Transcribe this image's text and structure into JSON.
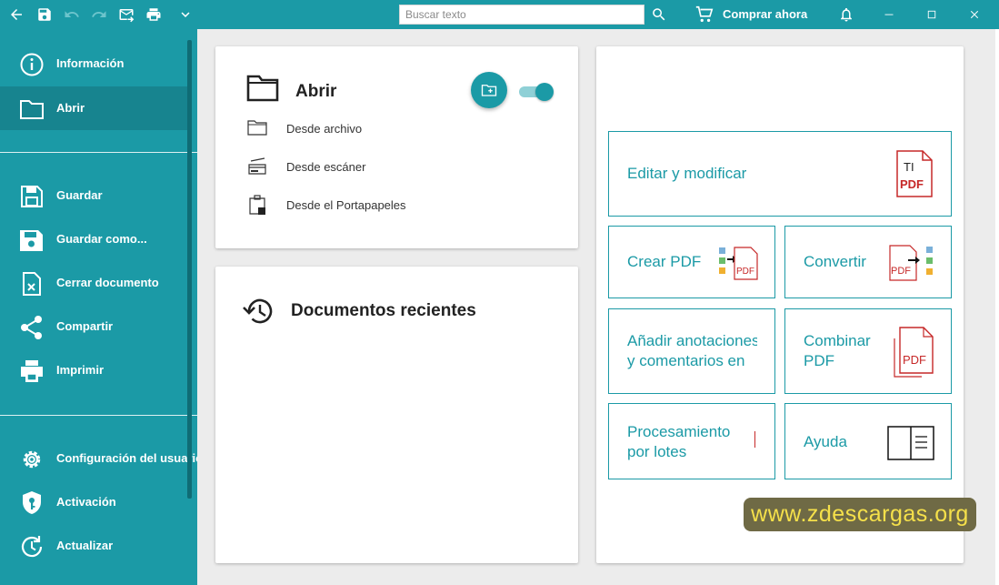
{
  "titlebar": {
    "search_placeholder": "Buscar texto",
    "buy_label": "Comprar ahora"
  },
  "sidebar": {
    "items": [
      {
        "label": "Información"
      },
      {
        "label": "Abrir"
      },
      {
        "label": "Guardar"
      },
      {
        "label": "Guardar como..."
      },
      {
        "label": "Cerrar documento"
      },
      {
        "label": "Compartir"
      },
      {
        "label": "Imprimir"
      },
      {
        "label": "Configuración del usuario"
      },
      {
        "label": "Activación"
      },
      {
        "label": "Actualizar"
      }
    ]
  },
  "open_panel": {
    "title": "Abrir",
    "options": [
      {
        "label": "Desde archivo"
      },
      {
        "label": "Desde escáner"
      },
      {
        "label": "Desde el Portapapeles"
      }
    ]
  },
  "recent_panel": {
    "title": "Documentos recientes"
  },
  "tools": {
    "edit": "Editar y modificar",
    "create": "Crear PDF",
    "convert": "Convertir",
    "annotate_line1": "Añadir anotaciones",
    "annotate_line2": "y comentarios en",
    "combine_line1": "Combinar",
    "combine_line2": "PDF",
    "batch_line1": "Procesamiento",
    "batch_line2": "por lotes",
    "help": "Ayuda"
  },
  "icons": {
    "pdf_badge": "PDF",
    "edit_glyph": "TI"
  },
  "watermark": "www.zdescargas.org",
  "colors": {
    "accent": "#1b9aa6",
    "pdf_red": "#c62828"
  }
}
